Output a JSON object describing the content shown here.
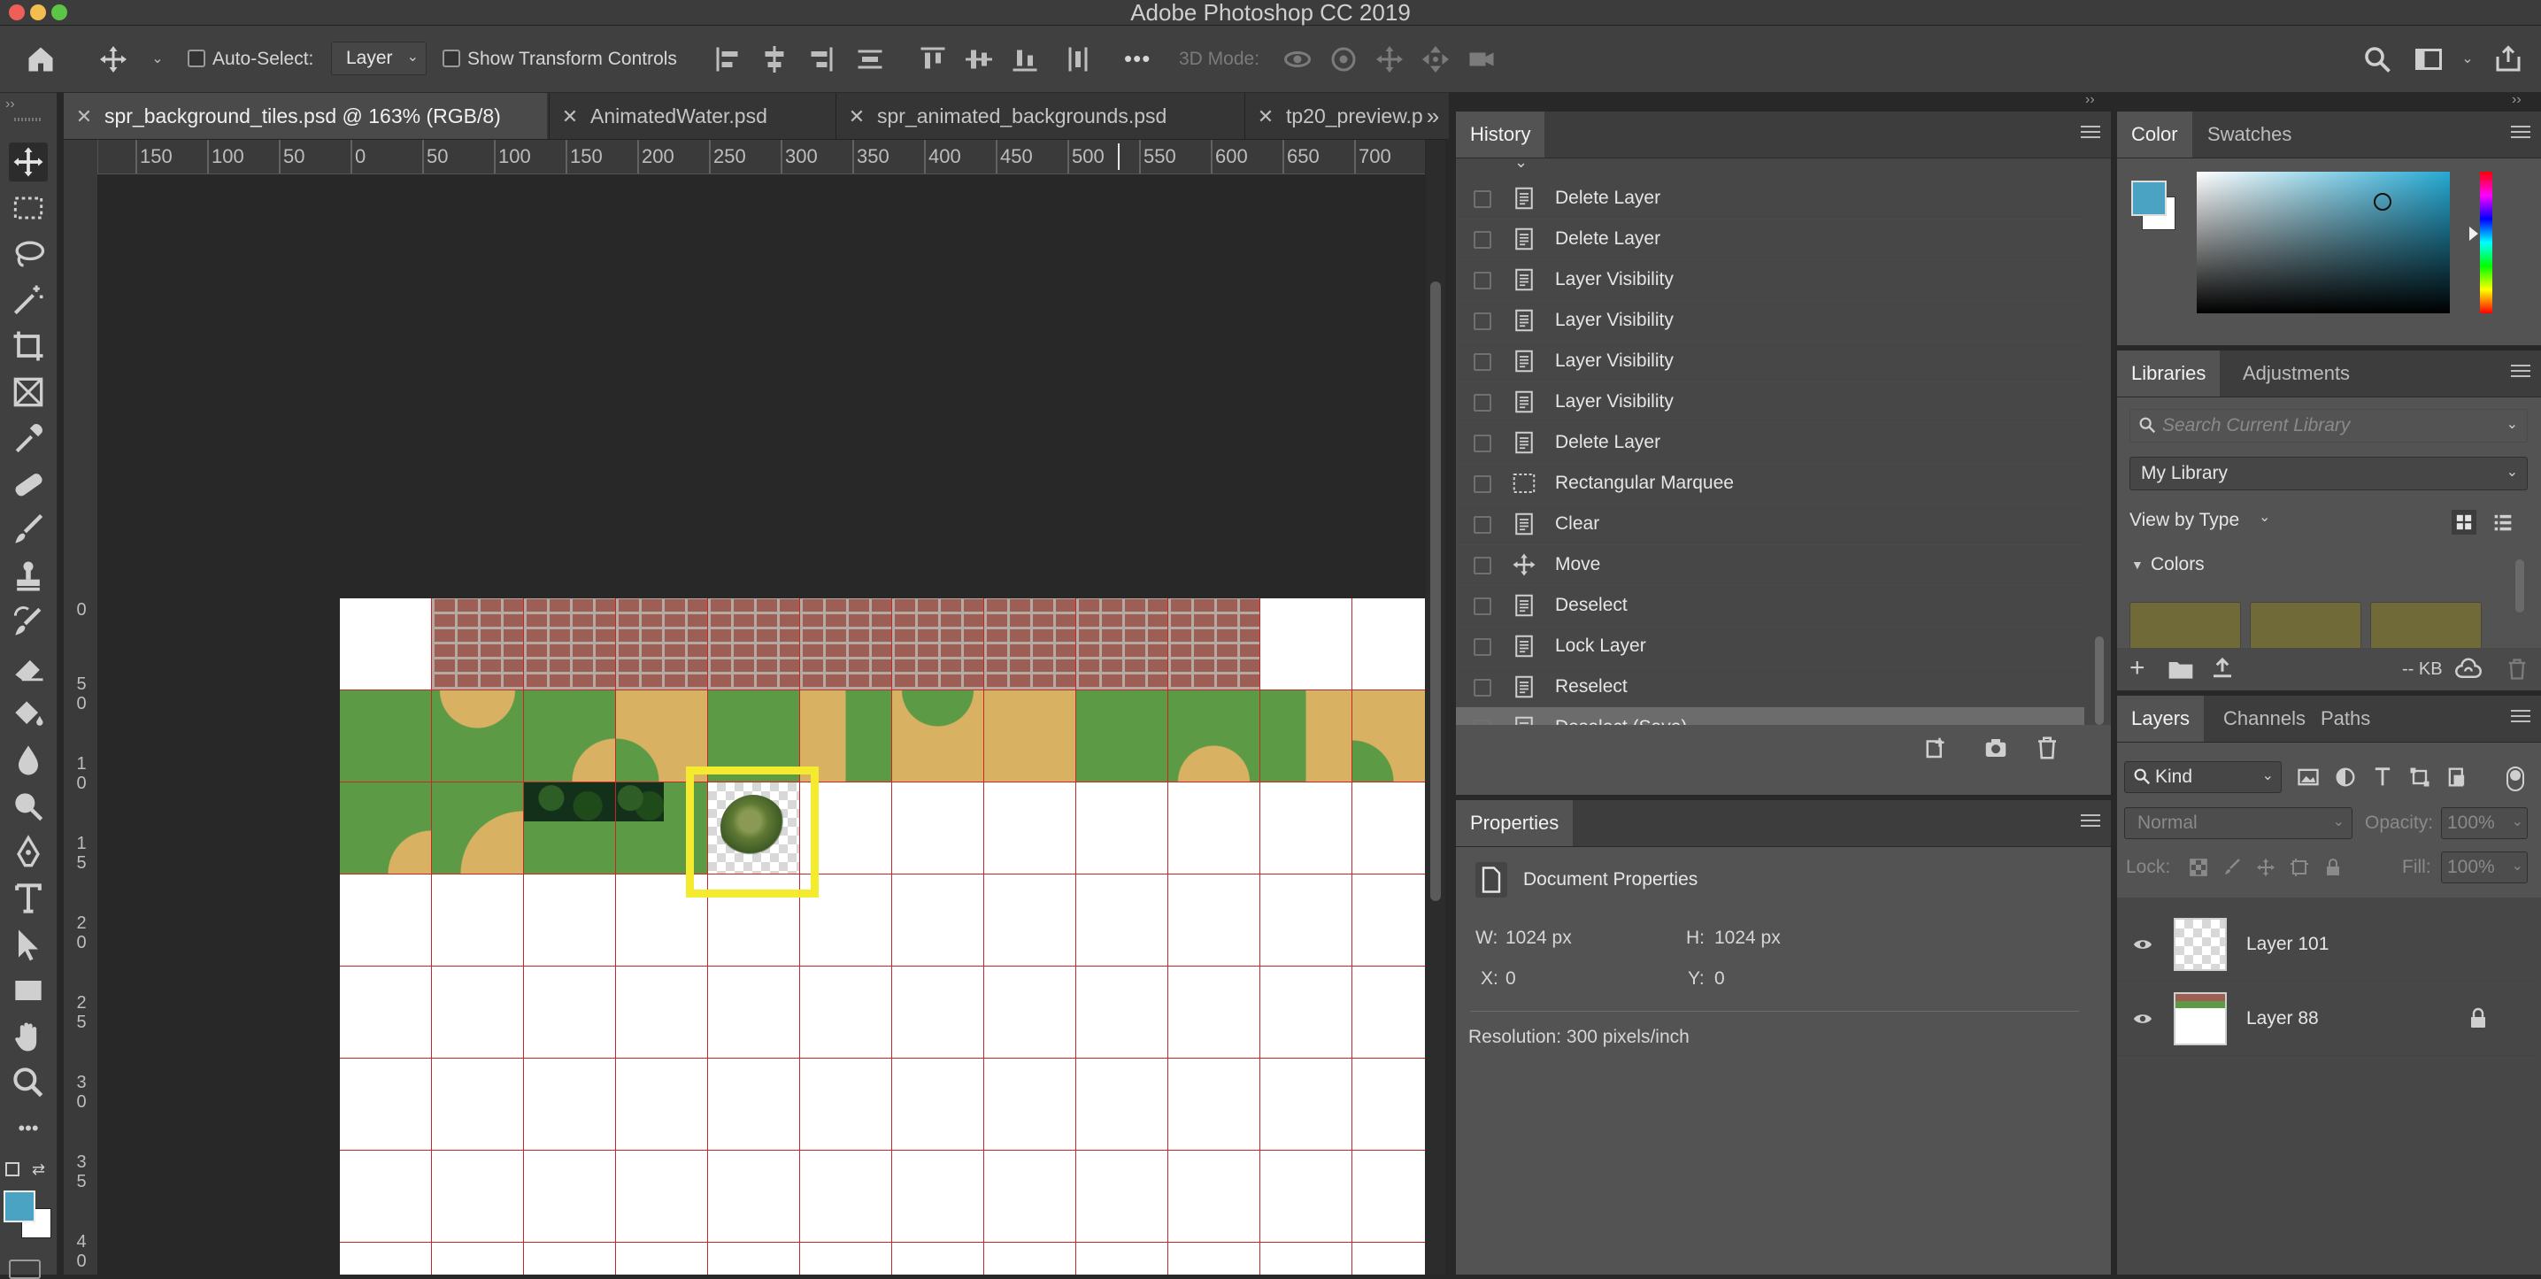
{
  "app": {
    "title": "Adobe Photoshop CC 2019"
  },
  "options_bar": {
    "auto_select_label": "Auto-Select:",
    "auto_select_value": "Layer",
    "show_transform_label": "Show Transform Controls",
    "more": "•••",
    "mode_3d_label": "3D Mode:"
  },
  "tabs": [
    {
      "label": "spr_background_tiles.psd @ 163% (RGB/8)",
      "active": true
    },
    {
      "label": "AnimatedWater.psd",
      "active": false
    },
    {
      "label": "spr_animated_backgrounds.psd",
      "active": false
    },
    {
      "label": "tp20_preview.p",
      "active": false
    }
  ],
  "tab_overflow": "»",
  "ruler_h": [
    "150",
    "100",
    "50",
    "0",
    "50",
    "100",
    "150",
    "200",
    "250",
    "300",
    "350",
    "400",
    "450",
    "500",
    "550",
    "600",
    "650",
    "700"
  ],
  "ruler_v": [
    {
      "d1": "0",
      "d2": ""
    },
    {
      "d1": "5",
      "d2": "0"
    },
    {
      "d1": "1",
      "d2": "0"
    },
    {
      "d1": "1",
      "d2": "5"
    },
    {
      "d1": "2",
      "d2": "0"
    },
    {
      "d1": "2",
      "d2": "5"
    },
    {
      "d1": "3",
      "d2": "0"
    },
    {
      "d1": "3",
      "d2": "5"
    },
    {
      "d1": "4",
      "d2": "0"
    }
  ],
  "history": {
    "tab": "History",
    "items": [
      "Delete Layer",
      "Delete Layer",
      "Layer Visibility",
      "Layer Visibility",
      "Layer Visibility",
      "Layer Visibility",
      "Delete Layer",
      "Rectangular Marquee",
      "Clear",
      "Move",
      "Deselect",
      "Lock Layer",
      "Reselect",
      "Deselect (Save)"
    ],
    "selected_index": 13
  },
  "properties": {
    "tab": "Properties",
    "section": "Document Properties",
    "w_label": "W:",
    "w_value": "1024 px",
    "h_label": "H:",
    "h_value": "1024 px",
    "x_label": "X:",
    "x_value": "0",
    "y_label": "Y:",
    "y_value": "0",
    "resolution": "Resolution: 300 pixels/inch"
  },
  "color_panel": {
    "tabs": [
      "Color",
      "Swatches"
    ],
    "foreground": "#4ba3c3",
    "background": "#ffffff",
    "hue_color": "#26a9d3"
  },
  "libraries": {
    "tabs": [
      "Libraries",
      "Adjustments"
    ],
    "search_placeholder": "Search Current Library",
    "library": "My Library",
    "view_by": "View by Type",
    "section": "Colors",
    "swatches": [
      "#6f6a37",
      "#6f6a37",
      "#6f6a37"
    ],
    "size": "-- KB"
  },
  "layers": {
    "tabs": [
      "Layers",
      "Channels",
      "Paths"
    ],
    "filter": "Kind",
    "blend_mode": "Normal",
    "opacity_label": "Opacity:",
    "opacity_value": "100%",
    "lock_label": "Lock:",
    "fill_label": "Fill:",
    "fill_value": "100%",
    "items": [
      {
        "name": "Layer 101",
        "locked": false
      },
      {
        "name": "Layer 88",
        "locked": true
      }
    ]
  }
}
